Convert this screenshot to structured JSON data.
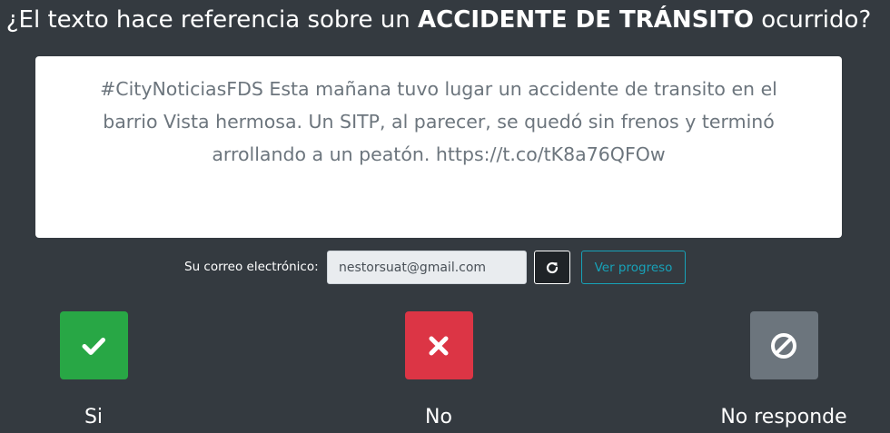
{
  "question": {
    "prefix": "¿El texto hace referencia sobre un",
    "emphasis": "ACCIDENTE DE TRÁNSITO",
    "suffix": "ocurrido?"
  },
  "tweet": {
    "text": "#CityNoticiasFDS Esta mañana tuvo lugar un accidente de transito en el barrio Vista hermosa. Un SITP, al parecer, se quedó sin frenos y terminó arrollando a un peatón. https://t.co/tK8a76QFOw"
  },
  "email": {
    "label": "Su correo electrónico:",
    "value": "nestorsuat@gmail.com",
    "refresh_icon": "refresh-icon",
    "progress_label": "Ver progreso"
  },
  "answers": [
    {
      "label": "Si",
      "icon": "check-icon",
      "color": "#28a745"
    },
    {
      "label": "No",
      "icon": "times-icon",
      "color": "#dc3545"
    },
    {
      "label": "No responde",
      "icon": "ban-icon",
      "color": "#6c757d"
    }
  ]
}
